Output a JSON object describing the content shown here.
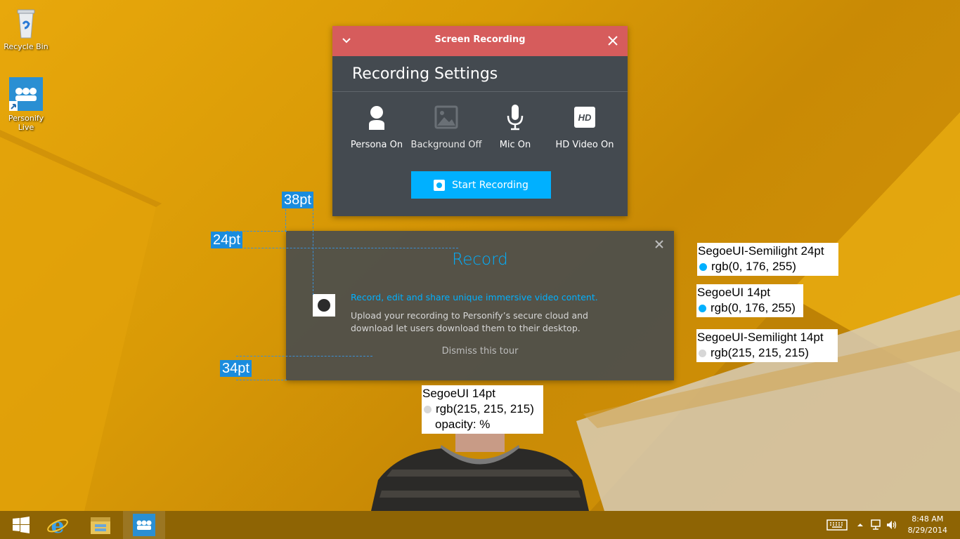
{
  "desktop": {
    "icons": [
      {
        "label": "Recycle Bin",
        "icon": "recycle-bin-icon"
      },
      {
        "label_lines": [
          "Personify",
          "Live"
        ],
        "icon": "personify-live-icon"
      }
    ]
  },
  "recording_panel": {
    "header_title": "Screen Recording",
    "header_color": "#d65c5c",
    "settings_title": "Recording Settings",
    "options": [
      {
        "label": "Persona On",
        "icon": "persona-icon",
        "state": "on"
      },
      {
        "label": "Background Off",
        "icon": "background-image-icon",
        "state": "off"
      },
      {
        "label": "Mic On",
        "icon": "microphone-icon",
        "state": "on"
      },
      {
        "label": "HD Video On",
        "icon": "hd-video-icon",
        "icon_text": "HD",
        "state": "on"
      }
    ],
    "start_button": "Start Recording",
    "accent": "#00b0ff"
  },
  "tour": {
    "heading": "Record",
    "lead": "Record, edit and share unique immersive video content.",
    "body": "Upload your recording to Personify’s secure cloud and download let users download them to their desktop.",
    "dismiss": "Dismiss this tour"
  },
  "annotations": {
    "measurements": [
      "38pt",
      "24pt",
      "34pt"
    ],
    "notes": [
      {
        "font": "SegoeUI-Semilight 24pt",
        "color_text": "rgb(0, 176, 255)",
        "dot": "#00b0ff"
      },
      {
        "font": "SegoeUI 14pt",
        "color_text": "rgb(0, 176, 255)",
        "dot": "#00b0ff"
      },
      {
        "font": "SegoeUI-Semilight 14pt",
        "color_text": "rgb(215, 215, 215)",
        "dot": "#d7d7d7"
      },
      {
        "font": "SegoeUI 14pt",
        "color_text": "rgb(215, 215, 215)",
        "dot": "#d7d7d7",
        "extra": "opacity: %"
      }
    ]
  },
  "taskbar": {
    "apps": [
      "start-icon",
      "internet-explorer-icon",
      "file-explorer-icon",
      "personify-icon"
    ],
    "tray": [
      "keyboard-icon",
      "show-hidden-icons-icon",
      "network-icon",
      "volume-icon"
    ],
    "time": "8:48 AM",
    "date": "8/29/2014"
  }
}
